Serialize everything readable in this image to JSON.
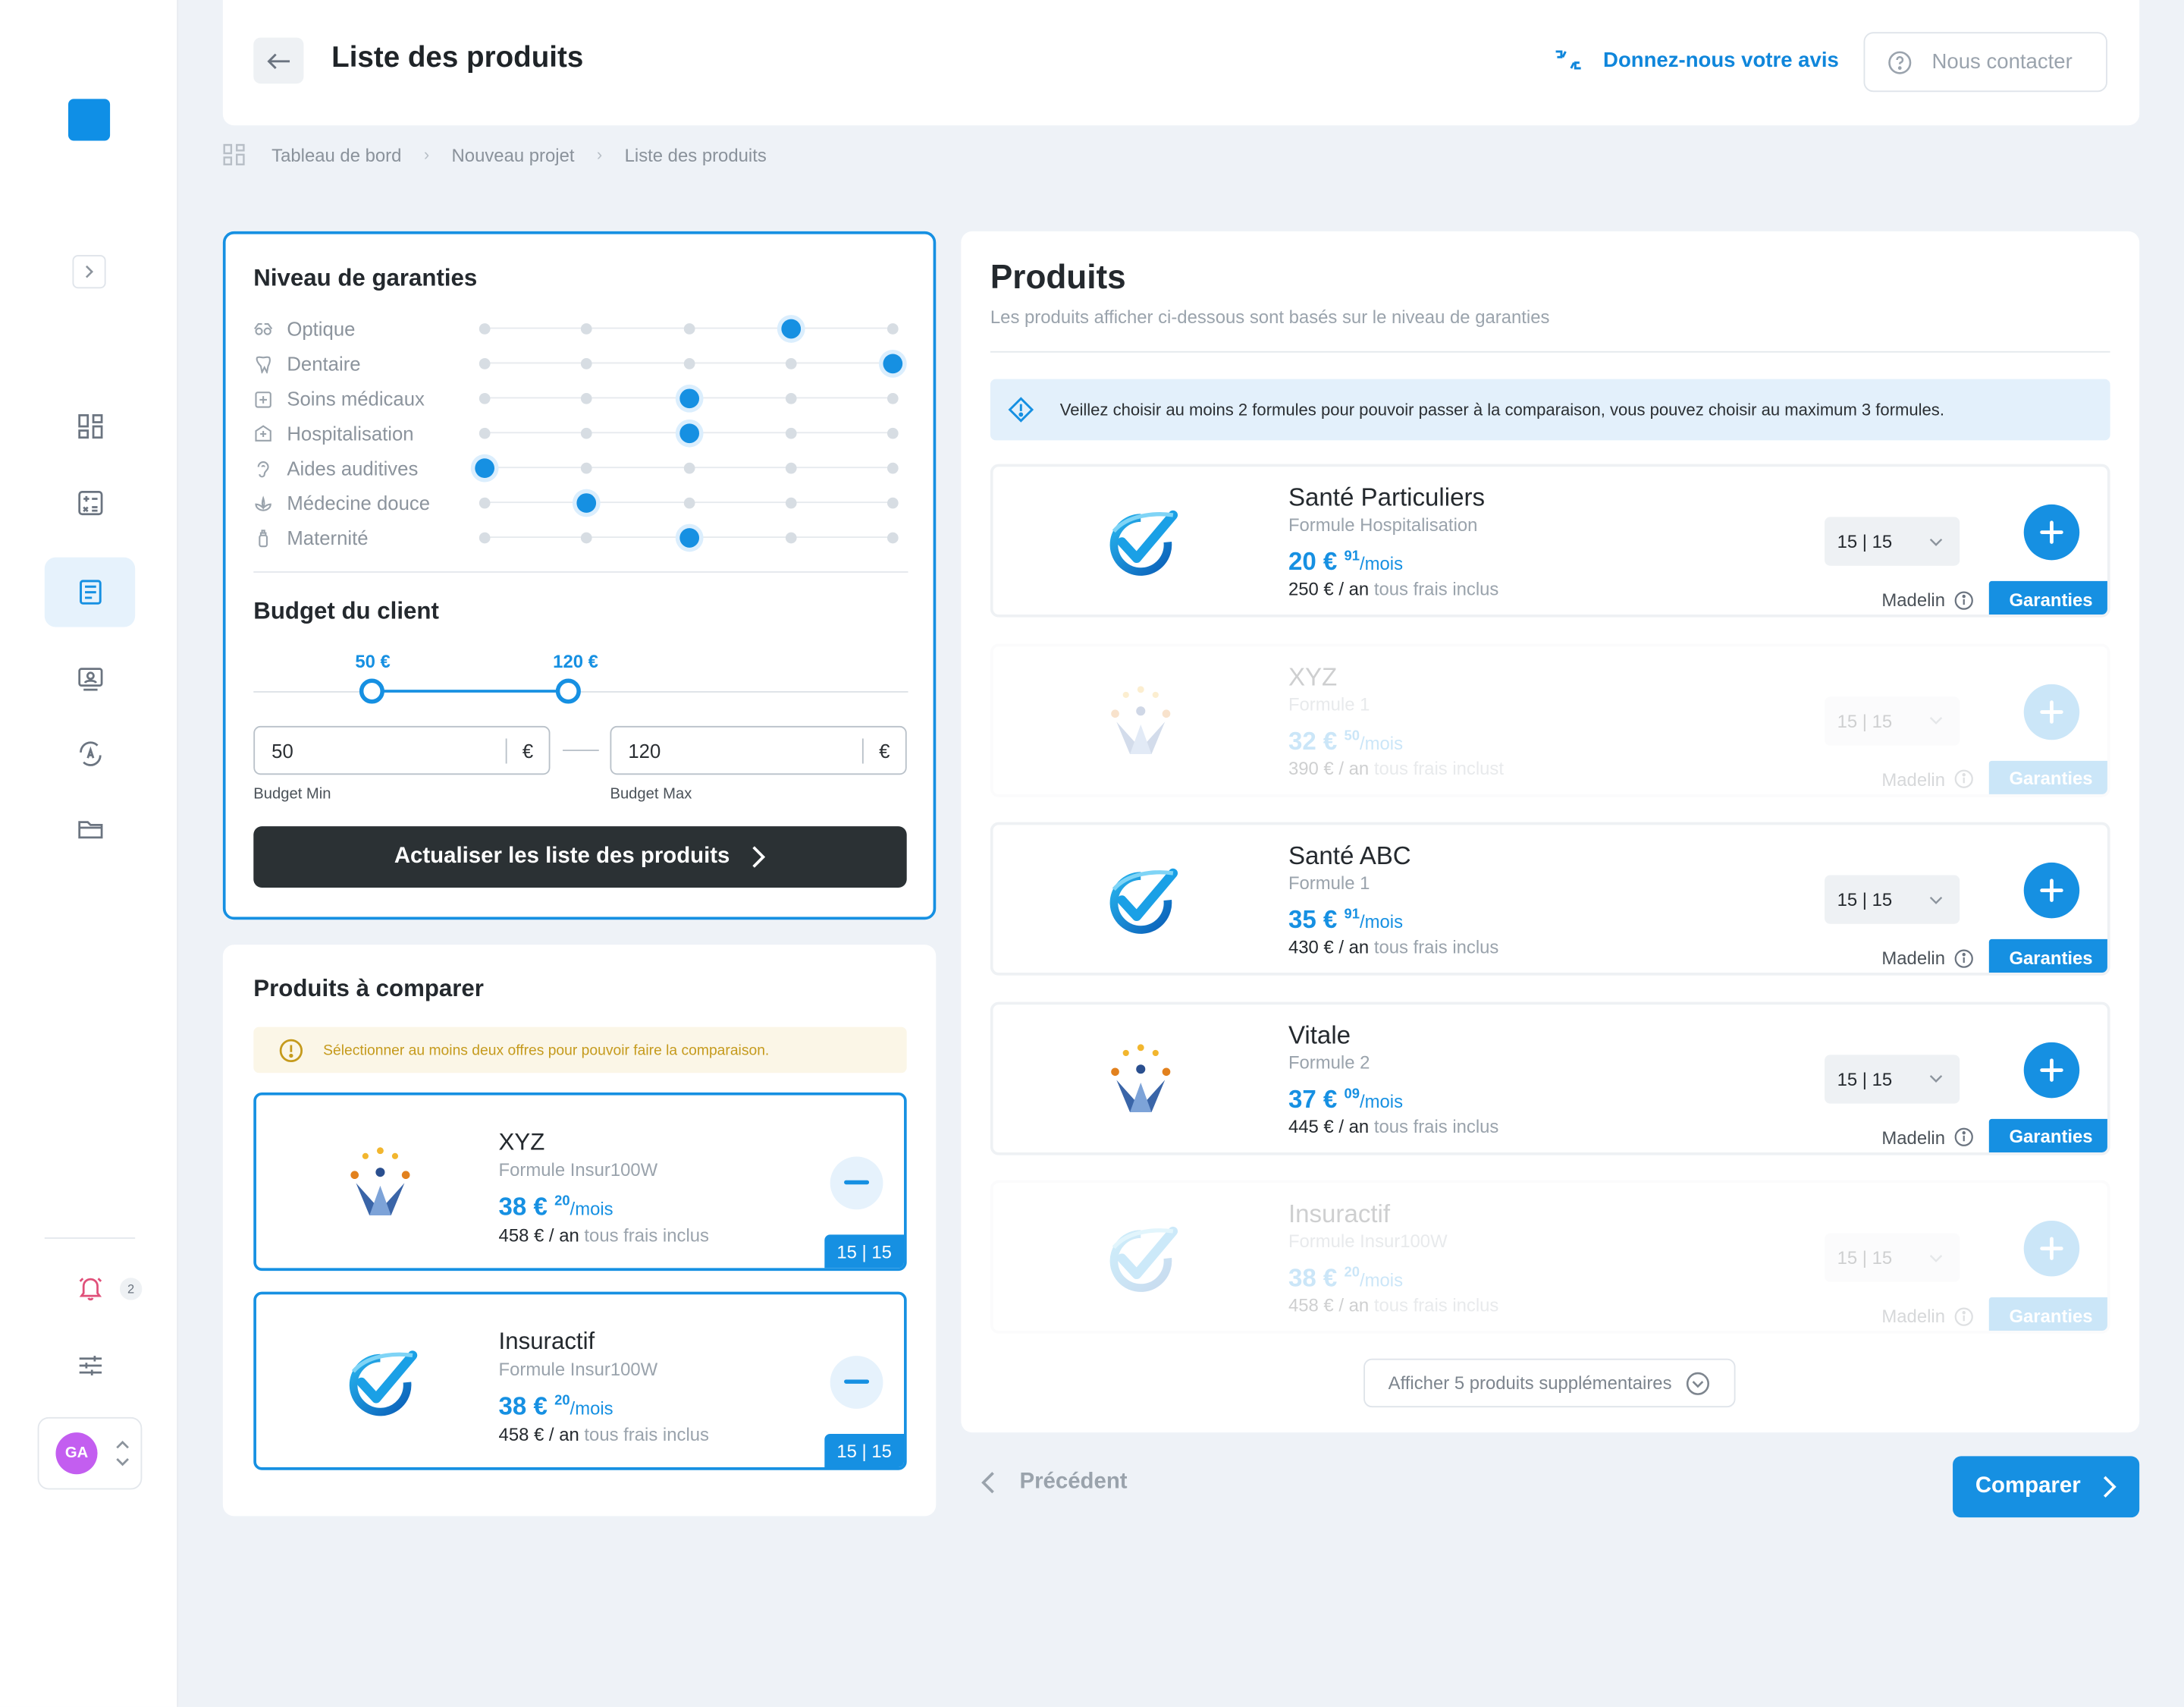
{
  "header": {
    "title": "Liste des produits",
    "feedback_label": "Donnez-nous votre avis",
    "contact_label": "Nous contacter"
  },
  "breadcrumb": [
    "Tableau de bord",
    "Nouveau projet",
    "Liste des produits"
  ],
  "sidebar": {
    "notification_count": "2",
    "user_initials": "GA",
    "items": [
      "dashboard-icon",
      "calculator-icon",
      "document-icon",
      "contacts-icon",
      "translate-icon",
      "folder-icon"
    ],
    "active_index": 2
  },
  "filters": {
    "title": "Niveau de garanties",
    "garanties": [
      {
        "label": "Optique",
        "icon": "glasses-icon",
        "level": 4
      },
      {
        "label": "Dentaire",
        "icon": "tooth-icon",
        "level": 5
      },
      {
        "label": "Soins médicaux",
        "icon": "medical-icon",
        "level": 3
      },
      {
        "label": "Hospitalisation",
        "icon": "hospital-icon",
        "level": 3
      },
      {
        "label": "Aides auditives",
        "icon": "ear-icon",
        "level": 1
      },
      {
        "label": "Médecine douce",
        "icon": "lotus-icon",
        "level": 2
      },
      {
        "label": "Maternité",
        "icon": "baby-bottle-icon",
        "level": 3
      }
    ],
    "levels_count": 5,
    "budget_title": "Budget du client",
    "budget_min_label": "50 €",
    "budget_max_label": "120 €",
    "budget_min_value": "50",
    "budget_max_value": "120",
    "currency": "€",
    "budget_min_caption": "Budget Min",
    "budget_max_caption": "Budget Max",
    "update_label": "Actualiser les liste des produits"
  },
  "compare": {
    "title": "Produits à comparer",
    "warning": "Sélectionner au moins deux offres pour pouvoir faire la comparaison.",
    "items": [
      {
        "name": "XYZ",
        "formula": "Formule Insur100W",
        "price_int": "38 €",
        "price_dec": "20",
        "per": "/mois",
        "annual": "458 € / an",
        "inc": "tous frais inclus",
        "tag": "15 | 15",
        "logo": "people-logo"
      },
      {
        "name": "Insuractif",
        "formula": "Formule Insur100W",
        "price_int": "38 €",
        "price_dec": "20",
        "per": "/mois",
        "annual": "458 € / an",
        "inc": "tous frais inclus",
        "tag": "15 | 15",
        "logo": "check-logo"
      }
    ]
  },
  "products": {
    "title": "Produits",
    "subtitle": "Les produits afficher ci-dessous sont basés sur le niveau de garanties",
    "info": "Veillez choisir au moins 2 formules pour pouvoir passer à la comparaison, vous pouvez choisir au maximum 3 formules.",
    "items": [
      {
        "name": "Santé Particuliers",
        "formula": "Formule Hospitalisation",
        "price_int": "20 €",
        "price_dec": "91",
        "per": "/mois",
        "annual": "250 € / an",
        "inc": "tous frais inclus",
        "qty": "15 | 15",
        "madelin": "Madelin",
        "garanties": "Garanties",
        "logo": "check-logo",
        "dim": false
      },
      {
        "name": "XYZ",
        "formula": "Formule 1",
        "price_int": "32 €",
        "price_dec": "50",
        "per": "/mois",
        "annual": "390 € / an",
        "inc": "tous frais inclust",
        "qty": "15 | 15",
        "madelin": "Madelin",
        "garanties": "Garanties",
        "logo": "people-logo",
        "dim": true
      },
      {
        "name": "Santé ABC",
        "formula": "Formule 1",
        "price_int": "35 €",
        "price_dec": "91",
        "per": "/mois",
        "annual": "430 € / an",
        "inc": "tous frais inclus",
        "qty": "15 | 15",
        "madelin": "Madelin",
        "garanties": "Garanties",
        "logo": "check-logo",
        "dim": false
      },
      {
        "name": "Vitale",
        "formula": "Formule 2",
        "price_int": "37 €",
        "price_dec": "09",
        "per": "/mois",
        "annual": "445 € / an",
        "inc": "tous frais inclus",
        "qty": "15 | 15",
        "madelin": "Madelin",
        "garanties": "Garanties",
        "logo": "people-logo",
        "dim": false
      },
      {
        "name": "Insuractif",
        "formula": "Formule Insur100W",
        "price_int": "38 €",
        "price_dec": "20",
        "per": "/mois",
        "annual": "458 € / an",
        "inc": "tous frais inclus",
        "qty": "15 | 15",
        "madelin": "Madelin",
        "garanties": "Garanties",
        "logo": "check-logo",
        "dim": true
      }
    ],
    "more_label": "Afficher 5 produits supplémentaires"
  },
  "footer": {
    "prev_label": "Précédent",
    "compare_label": "Comparer"
  },
  "colors": {
    "accent": "#1690e2",
    "dark_button": "#2b3134",
    "background": "#eef2f7"
  }
}
